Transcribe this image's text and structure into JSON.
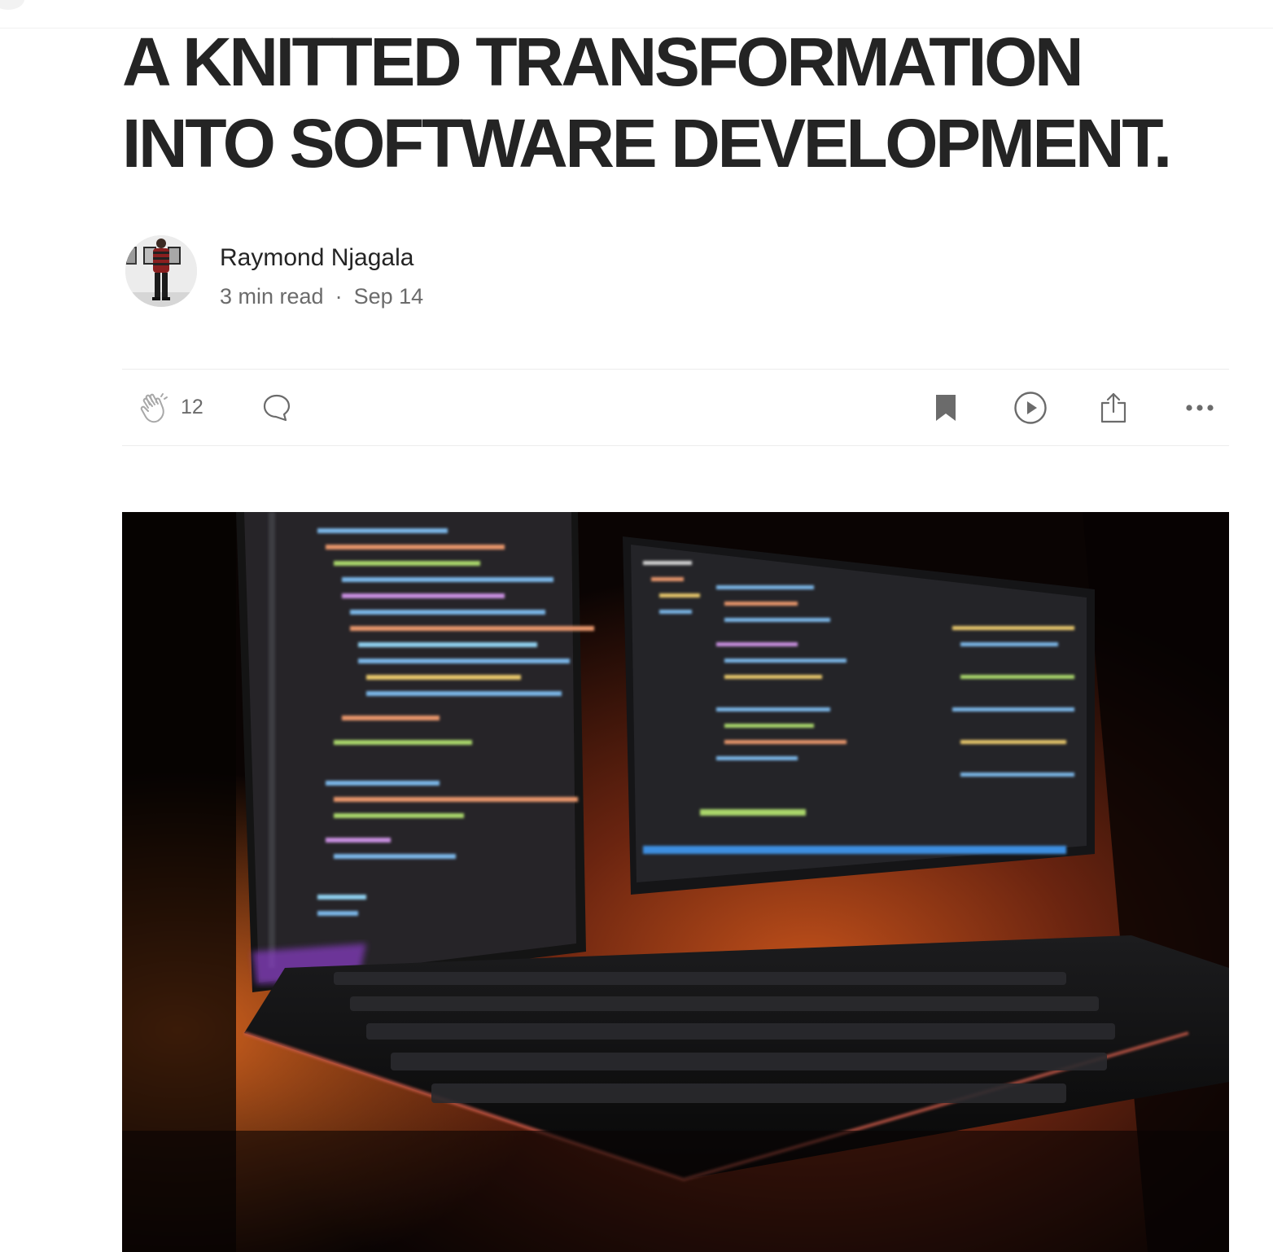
{
  "article": {
    "title_line1": "A KNITTED TRANSFORMATION",
    "title_line2": "INTO SOFTWARE DEVELOPMENT."
  },
  "author": {
    "name": "Raymond Njagala",
    "read_time": "3 min read",
    "separator": "·",
    "date": "Sep 14"
  },
  "actions": {
    "clap_count": "12",
    "icons": [
      "clap-icon",
      "comment-icon",
      "bookmark-icon",
      "play-icon",
      "share-icon",
      "more-icon"
    ]
  },
  "colors": {
    "text": "#242424",
    "muted": "#6b6b6b",
    "divider": "#ececec"
  }
}
